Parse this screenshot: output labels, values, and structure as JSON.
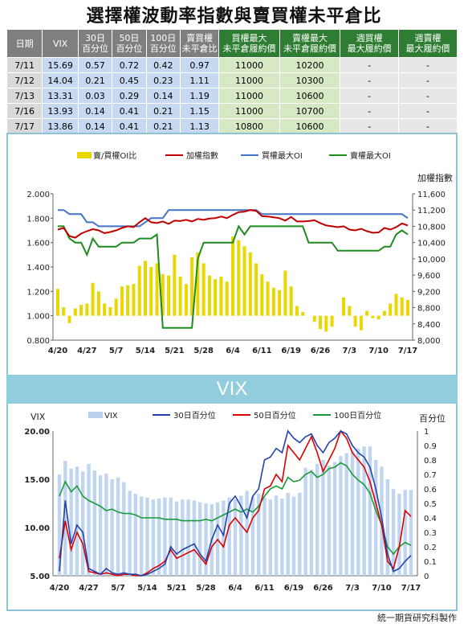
{
  "title": "選擇權波動率指數與賣買權未平倉比",
  "table": {
    "headers": [
      {
        "l1": "日期",
        "l2": ""
      },
      {
        "l1": "VIX",
        "l2": ""
      },
      {
        "l1": "30日",
        "l2": "百分位"
      },
      {
        "l1": "50日",
        "l2": "百分位"
      },
      {
        "l1": "100日",
        "l2": "百分位"
      },
      {
        "l1": "賣買權",
        "l2": "未平倉比"
      },
      {
        "l1": "買權最大",
        "l2": "未平倉履約價"
      },
      {
        "l1": "賣權最大",
        "l2": "未平倉履約價"
      },
      {
        "l1": "週買權",
        "l2": "最大履約價"
      },
      {
        "l1": "週賣權",
        "l2": "最大履約價"
      }
    ],
    "rows": [
      [
        "7/11",
        "15.69",
        "0.57",
        "0.72",
        "0.42",
        "0.97",
        "11000",
        "10200",
        "-",
        "-"
      ],
      [
        "7/12",
        "14.04",
        "0.21",
        "0.45",
        "0.23",
        "1.11",
        "11000",
        "10300",
        "-",
        "-"
      ],
      [
        "7/13",
        "13.31",
        "0.03",
        "0.29",
        "0.14",
        "1.19",
        "11000",
        "10600",
        "-",
        "-"
      ],
      [
        "7/16",
        "13.93",
        "0.14",
        "0.41",
        "0.21",
        "1.15",
        "11000",
        "10700",
        "-",
        "-"
      ],
      [
        "7/17",
        "13.86",
        "0.14",
        "0.41",
        "0.21",
        "1.13",
        "10800",
        "10600",
        "-",
        "-"
      ]
    ]
  },
  "vix_band_label": "VIX",
  "footer": "統一期貨研究科製作",
  "chart_data": [
    {
      "type": "bar+line",
      "legend": [
        "賣/買權OI比",
        "加權指數",
        "買權最大OI",
        "賣權最大OI"
      ],
      "colors": {
        "ratio": "#e8d800",
        "index": "#c00000",
        "callOI": "#4472c4",
        "putOI": "#1e8c1e"
      },
      "xticks": [
        "4/20",
        "4/27",
        "5/7",
        "5/14",
        "5/21",
        "5/28",
        "6/4",
        "6/11",
        "6/19",
        "6/26",
        "7/3",
        "7/10",
        "7/17"
      ],
      "y_left": {
        "min": 0.8,
        "max": 2.0,
        "step": 0.2,
        "labels": [
          "0.800",
          "1.000",
          "1.200",
          "1.400",
          "1.600",
          "1.800",
          "2.000"
        ]
      },
      "y_right": {
        "label": "加權指數",
        "min": 8000,
        "max": 11600,
        "step": 400,
        "labels": [
          "8,000",
          "8,400",
          "8,800",
          "9,200",
          "9,600",
          "10,000",
          "10,400",
          "10,800",
          "11,200",
          "11,600"
        ]
      },
      "ratio": [
        1.22,
        1.07,
        0.94,
        1.06,
        1.09,
        1.1,
        1.27,
        1.2,
        1.1,
        1.07,
        1.14,
        1.24,
        1.25,
        1.26,
        1.41,
        1.45,
        1.4,
        1.43,
        1.34,
        1.33,
        1.5,
        1.32,
        1.26,
        1.48,
        1.52,
        1.43,
        1.33,
        1.3,
        1.32,
        1.28,
        1.65,
        1.62,
        1.57,
        1.52,
        1.43,
        1.34,
        1.28,
        1.23,
        1.21,
        1.37,
        1.24,
        1.08,
        1.03,
        1.0,
        0.95,
        0.89,
        0.87,
        0.91,
        1.0,
        1.15,
        1.08,
        0.91,
        0.88,
        1.04,
        0.98,
        0.97,
        1.04,
        1.1,
        1.18,
        1.15,
        1.13
      ],
      "index": [
        10720,
        10760,
        10560,
        10520,
        10620,
        10680,
        10730,
        10700,
        10630,
        10660,
        10700,
        10760,
        10800,
        10780,
        10900,
        11000,
        10900,
        10880,
        10920,
        10860,
        10940,
        10930,
        10960,
        10920,
        10980,
        10960,
        10990,
        11000,
        11040,
        11000,
        11080,
        11150,
        11160,
        11200,
        11180,
        11050,
        11040,
        11020,
        11000,
        10940,
        11030,
        10920,
        10920,
        10930,
        10950,
        10880,
        10820,
        10800,
        10780,
        10800,
        10720,
        10700,
        10740,
        10680,
        10640,
        10650,
        10760,
        10720,
        10780,
        10870,
        10820
      ],
      "callOI": [
        11200,
        11200,
        11100,
        11100,
        11100,
        10900,
        10900,
        10800,
        10800,
        10800,
        10800,
        10800,
        10800,
        10800,
        10800,
        10900,
        11000,
        11000,
        11000,
        11200,
        11200,
        11200,
        11200,
        11200,
        11200,
        11200,
        11200,
        11200,
        11200,
        11200,
        11200,
        11200,
        11200,
        11200,
        11200,
        11100,
        11100,
        11100,
        11100,
        11100,
        11100,
        11100,
        11100,
        11100,
        11100,
        11100,
        11100,
        11100,
        11100,
        11100,
        11100,
        11100,
        11100,
        11100,
        11100,
        11100,
        11100,
        11100,
        11100,
        11100,
        11000
      ],
      "putOI": [
        10800,
        10800,
        10500,
        10400,
        10400,
        10100,
        10500,
        10300,
        10300,
        10300,
        10300,
        10400,
        10400,
        10400,
        10500,
        10500,
        10500,
        10600,
        8300,
        8300,
        8300,
        8300,
        8300,
        8300,
        10000,
        10400,
        10400,
        10400,
        10400,
        10400,
        10400,
        10800,
        10600,
        10800,
        10800,
        10800,
        10800,
        10800,
        10800,
        10800,
        10800,
        10800,
        10800,
        10400,
        10400,
        10400,
        10400,
        10400,
        10200,
        10200,
        10200,
        10200,
        10200,
        10200,
        10200,
        10200,
        10300,
        10300,
        10600,
        10700,
        10600
      ]
    },
    {
      "type": "bar+line",
      "legend": [
        "VIX",
        "30日百分位",
        "50日百分位",
        "100日百分位"
      ],
      "colors": {
        "vix": "#b8d0ee",
        "p30": "#2244aa",
        "p50": "#dd0000",
        "p100": "#1a9a3a"
      },
      "xticks": [
        "4/20",
        "4/27",
        "5/7",
        "5/14",
        "5/21",
        "5/28",
        "6/4",
        "6/11",
        "6/19",
        "6/26",
        "7/3",
        "7/10",
        "7/17"
      ],
      "y_left": {
        "label": "VIX",
        "min": 5.0,
        "max": 20.0,
        "labels": [
          "5.00",
          "10.00",
          "15.00",
          "20.00"
        ]
      },
      "y_right": {
        "label": "百分位",
        "min": 0,
        "max": 1,
        "labels": [
          "0",
          "0.1",
          "0.2",
          "0.3",
          "0.4",
          "0.5",
          "0.6",
          "0.7",
          "0.8",
          "0.9",
          "1"
        ]
      },
      "vix": [
        15.5,
        16.9,
        16.1,
        16.3,
        15.8,
        16.6,
        15.9,
        15.4,
        15.6,
        15.0,
        15.2,
        14.7,
        13.8,
        13.5,
        13.2,
        13.1,
        12.9,
        13.0,
        13.1,
        13.1,
        12.7,
        12.9,
        12.9,
        12.8,
        12.6,
        12.5,
        12.4,
        12.6,
        12.8,
        13.1,
        12.9,
        13.3,
        13.8,
        13.2,
        13.5,
        13.1,
        12.9,
        13.3,
        13.0,
        13.6,
        13.2,
        13.6,
        16.2,
        16.0,
        16.6,
        17.0,
        16.4,
        16.8,
        17.4,
        17.7,
        17.9,
        18.2,
        18.4,
        18.4,
        17.0,
        16.3,
        15.0,
        14.0,
        13.5,
        13.9,
        13.9
      ],
      "p30": [
        0.03,
        0.52,
        0.22,
        0.35,
        0.3,
        0.05,
        0.03,
        0.01,
        0.05,
        0.02,
        0.01,
        0.02,
        0.01,
        0.01,
        0.0,
        0.01,
        0.03,
        0.05,
        0.08,
        0.2,
        0.15,
        0.18,
        0.2,
        0.22,
        0.15,
        0.1,
        0.25,
        0.35,
        0.28,
        0.5,
        0.55,
        0.48,
        0.4,
        0.55,
        0.6,
        0.8,
        0.82,
        0.88,
        0.85,
        1.0,
        0.95,
        0.92,
        0.96,
        0.98,
        0.9,
        0.85,
        0.92,
        0.95,
        1.0,
        0.98,
        0.9,
        0.85,
        0.82,
        0.75,
        0.6,
        0.4,
        0.15,
        0.03,
        0.05,
        0.1,
        0.14
      ],
      "p50": [
        0.12,
        0.38,
        0.18,
        0.3,
        0.22,
        0.03,
        0.02,
        0.01,
        0.02,
        0.01,
        0.0,
        0.01,
        0.01,
        0.0,
        0.0,
        0.02,
        0.05,
        0.07,
        0.1,
        0.18,
        0.12,
        0.14,
        0.16,
        0.18,
        0.13,
        0.08,
        0.2,
        0.25,
        0.2,
        0.35,
        0.4,
        0.35,
        0.3,
        0.4,
        0.45,
        0.6,
        0.62,
        0.7,
        0.65,
        0.9,
        0.85,
        0.8,
        0.88,
        0.96,
        0.85,
        0.72,
        0.8,
        0.88,
        1.0,
        0.95,
        0.85,
        0.8,
        0.75,
        0.65,
        0.5,
        0.35,
        0.1,
        0.05,
        0.2,
        0.45,
        0.41
      ],
      "p100": [
        0.55,
        0.65,
        0.58,
        0.62,
        0.55,
        0.52,
        0.5,
        0.48,
        0.45,
        0.46,
        0.44,
        0.43,
        0.43,
        0.42,
        0.4,
        0.4,
        0.4,
        0.4,
        0.39,
        0.39,
        0.39,
        0.38,
        0.38,
        0.38,
        0.38,
        0.39,
        0.38,
        0.4,
        0.42,
        0.44,
        0.46,
        0.44,
        0.46,
        0.44,
        0.48,
        0.55,
        0.6,
        0.62,
        0.6,
        0.68,
        0.65,
        0.66,
        0.7,
        0.72,
        0.68,
        0.7,
        0.74,
        0.75,
        0.78,
        0.76,
        0.7,
        0.66,
        0.63,
        0.57,
        0.45,
        0.35,
        0.2,
        0.15,
        0.2,
        0.23,
        0.21
      ]
    }
  ]
}
